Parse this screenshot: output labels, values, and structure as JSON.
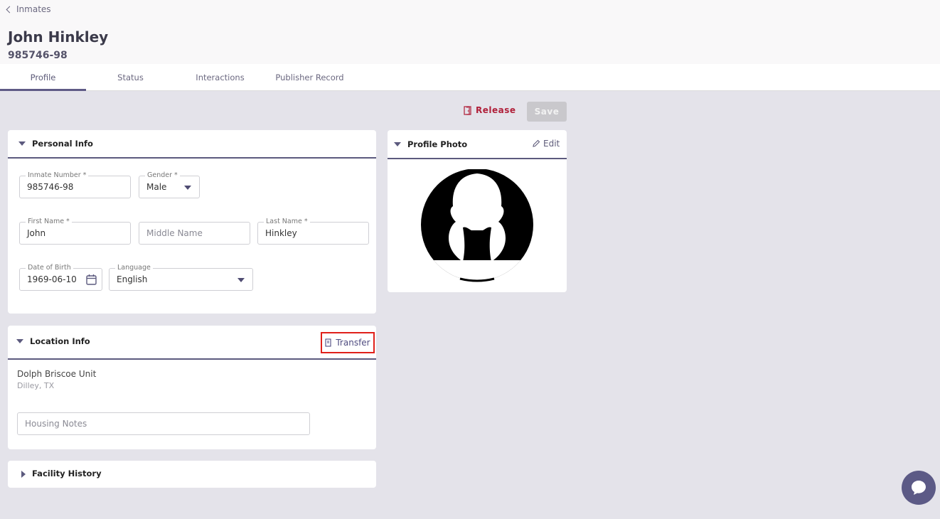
{
  "breadcrumb": {
    "label": "Inmates"
  },
  "header": {
    "name": "John Hinkley",
    "inmate_id": "985746-98"
  },
  "tabs": [
    "Profile",
    "Status",
    "Interactions",
    "Publisher Record"
  ],
  "actions": {
    "release": "Release",
    "save": "Save"
  },
  "personal_info": {
    "title": "Personal Info",
    "inmate_number": {
      "label": "Inmate Number *",
      "value": "985746-98"
    },
    "gender": {
      "label": "Gender *",
      "value": "Male"
    },
    "first_name": {
      "label": "First Name *",
      "value": "John"
    },
    "middle_name": {
      "placeholder": "Middle Name"
    },
    "last_name": {
      "label": "Last Name *",
      "value": "Hinkley"
    },
    "dob": {
      "label": "Date of Birth",
      "value": "1969-06-10"
    },
    "language": {
      "label": "Language",
      "value": "English"
    }
  },
  "profile_photo": {
    "title": "Profile Photo",
    "edit": "Edit"
  },
  "location_info": {
    "title": "Location Info",
    "transfer": "Transfer",
    "facility": "Dolph Briscoe Unit",
    "city": "Dilley, TX",
    "housing_notes_placeholder": "Housing Notes"
  },
  "facility_history": {
    "title": "Facility History"
  },
  "colors": {
    "accent": "#5c5a7e",
    "danger": "#b0203a",
    "highlight": "#e0201a"
  },
  "icons": [
    "chevron-left-icon",
    "release-icon",
    "pencil-icon",
    "calendar-icon",
    "transfer-icon",
    "chat-icon"
  ]
}
